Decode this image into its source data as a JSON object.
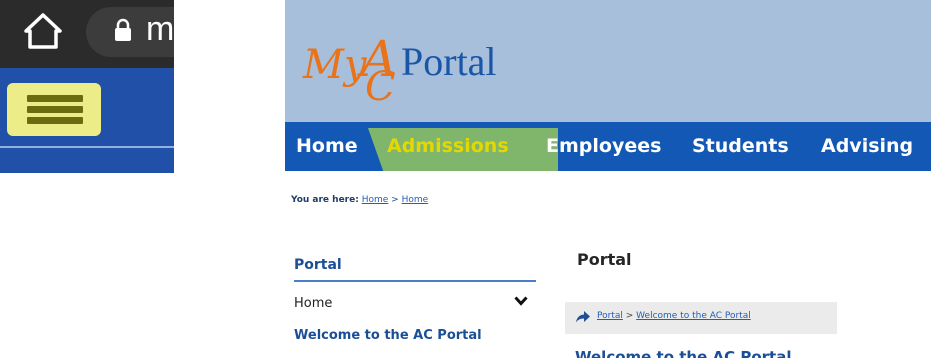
{
  "mobile": {
    "address_text": "m",
    "icons": {
      "home": "home-icon",
      "lock": "lock-icon",
      "menu": "hamburger-menu-icon"
    },
    "colors": {
      "toolbar": "#2b2b2b",
      "navbar": "#2050a8",
      "menu_highlight": "#ecec88"
    }
  },
  "portal": {
    "logo": {
      "my": "My",
      "a": "A",
      "c": "C",
      "portal": "Portal"
    },
    "nav": {
      "items": [
        {
          "label": "Home"
        },
        {
          "label": "Admissions"
        },
        {
          "label": "Employees"
        },
        {
          "label": "Students"
        },
        {
          "label": "Advising"
        }
      ]
    },
    "breadcrumb": {
      "prefix": "You are here:",
      "link1": "Home",
      "separator": ">",
      "link2": "Home"
    },
    "sidebar": {
      "title": "Portal",
      "items": [
        {
          "label": "Home"
        },
        {
          "label": "Welcome to the AC Portal"
        }
      ]
    },
    "main": {
      "title": "Portal",
      "path": {
        "link1": "Portal",
        "separator": ">",
        "link2": "Welcome to the AC Portal"
      },
      "heading": "Welcome to the AC Portal"
    },
    "colors": {
      "header": "#a8bfdb",
      "nav": "#1358b4",
      "highlight": "#80b56c",
      "active_nav_text": "#e4d800",
      "logo_orange": "#e8731a",
      "logo_blue": "#1a56a8"
    }
  }
}
